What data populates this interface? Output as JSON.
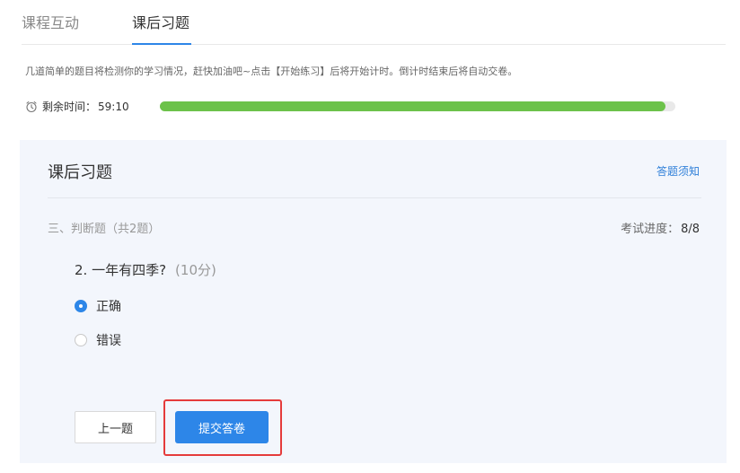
{
  "tabs": [
    {
      "label": "课程互动",
      "active": false
    },
    {
      "label": "课后习题",
      "active": true
    }
  ],
  "notice": "几道简单的题目将检测你的学习情况，赶快加油吧~点击【开始练习】后将开始计时。倒计时结束后将自动交卷。",
  "timer": {
    "icon": "alarm-clock-icon",
    "label": "剩余时间：",
    "value": "59:10"
  },
  "progress": {
    "fraction": 0.98,
    "color": "#6cc24a"
  },
  "panel": {
    "title": "课后习题",
    "link": "答题须知",
    "section": "三、判断题（共2题）",
    "exam_progress_label": "考试进度：",
    "exam_progress_value": "8/8"
  },
  "question": {
    "text": "2. 一年有四季?",
    "score": "(10分)",
    "options": [
      {
        "label": "正确",
        "selected": true
      },
      {
        "label": "错误",
        "selected": false
      }
    ]
  },
  "buttons": {
    "prev": "上一题",
    "submit": "提交答卷"
  },
  "colors": {
    "accent": "#2d86e8",
    "highlight": "#e53b3b"
  }
}
